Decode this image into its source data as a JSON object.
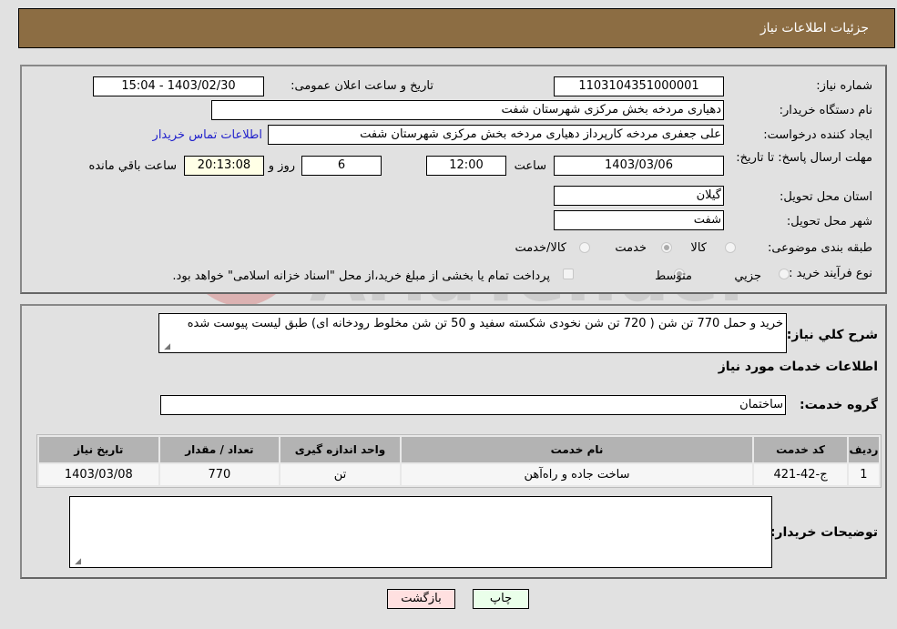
{
  "header": {
    "title": "جزئیات اطلاعات نیاز"
  },
  "details": {
    "need_number_label": "شماره نیاز:",
    "need_number": "1103104351000001",
    "announce_label": "تاریخ و ساعت اعلان عمومی:",
    "announce_value": "1403/02/30 - 15:04",
    "buyer_org_label": "نام دستگاه خریدار:",
    "buyer_org": "دهیاری مردخه بخش مرکزی شهرستان شفت",
    "creator_label": "ایجاد کننده درخواست:",
    "creator": "علی جعفری مردخه کارپرداز دهیاری مردخه بخش مرکزی شهرستان شفت",
    "contact_link": "اطلاعات تماس خریدار",
    "deadline_label": "مهلت ارسال پاسخ: تا تاریخ:",
    "deadline_date": "1403/03/06",
    "time_label": "ساعت",
    "deadline_time": "12:00",
    "days_value": "6",
    "days_label": "روز و",
    "remaining_time": "20:13:08",
    "remaining_label": "ساعت باقي مانده",
    "province_label": "استان محل تحویل:",
    "province": "گیلان",
    "city_label": "شهر محل تحویل:",
    "city": "شفت",
    "category_label": "طبقه بندی موضوعی:",
    "category_options": [
      {
        "label": "کالا",
        "checked": false
      },
      {
        "label": "خدمت",
        "checked": true
      },
      {
        "label": "کالا/خدمت",
        "checked": false
      }
    ],
    "process_label": "نوع فرآیند خرید :",
    "process_options": [
      {
        "label": "جزيي",
        "checked": false
      },
      {
        "label": "متوسط",
        "checked": true
      }
    ],
    "treasury_note": "پرداخت تمام یا بخشی از مبلغ خرید،از محل \"اسناد خزانه اسلامی\" خواهد بود."
  },
  "summary": {
    "label": "شرح کلي نياز:",
    "text": "خرید و حمل 770 تن شن ( 720 تن شن نخودی شکسته سفید و 50 تن شن مخلوط رودخانه ای) طبق لیست پیوست شده"
  },
  "services": {
    "section_title": "اطلاعات خدمات مورد نیاز",
    "group_label": "گروه خدمت:",
    "group_value": "ساختمان",
    "columns": [
      "ردیف",
      "کد خدمت",
      "نام خدمت",
      "واحد اندازه گیری",
      "تعداد / مقدار",
      "تاریخ نیاز"
    ],
    "rows": [
      {
        "row": "1",
        "code": "ج-42-421",
        "name": "ساخت جاده و راه‌آهن",
        "unit": "تن",
        "qty": "770",
        "date": "1403/03/08"
      }
    ]
  },
  "buyer_notes": {
    "label": "توضیحات خریدار:",
    "value": ""
  },
  "buttons": {
    "print": "چاپ",
    "back": "بازگشت"
  },
  "watermark": {
    "text": "AriaTender.neT"
  },
  "colors": {
    "header_bg": "#8c6d43",
    "print_bg": "#eaffea",
    "back_bg": "#ffe0e0",
    "link": "#2222cc"
  }
}
